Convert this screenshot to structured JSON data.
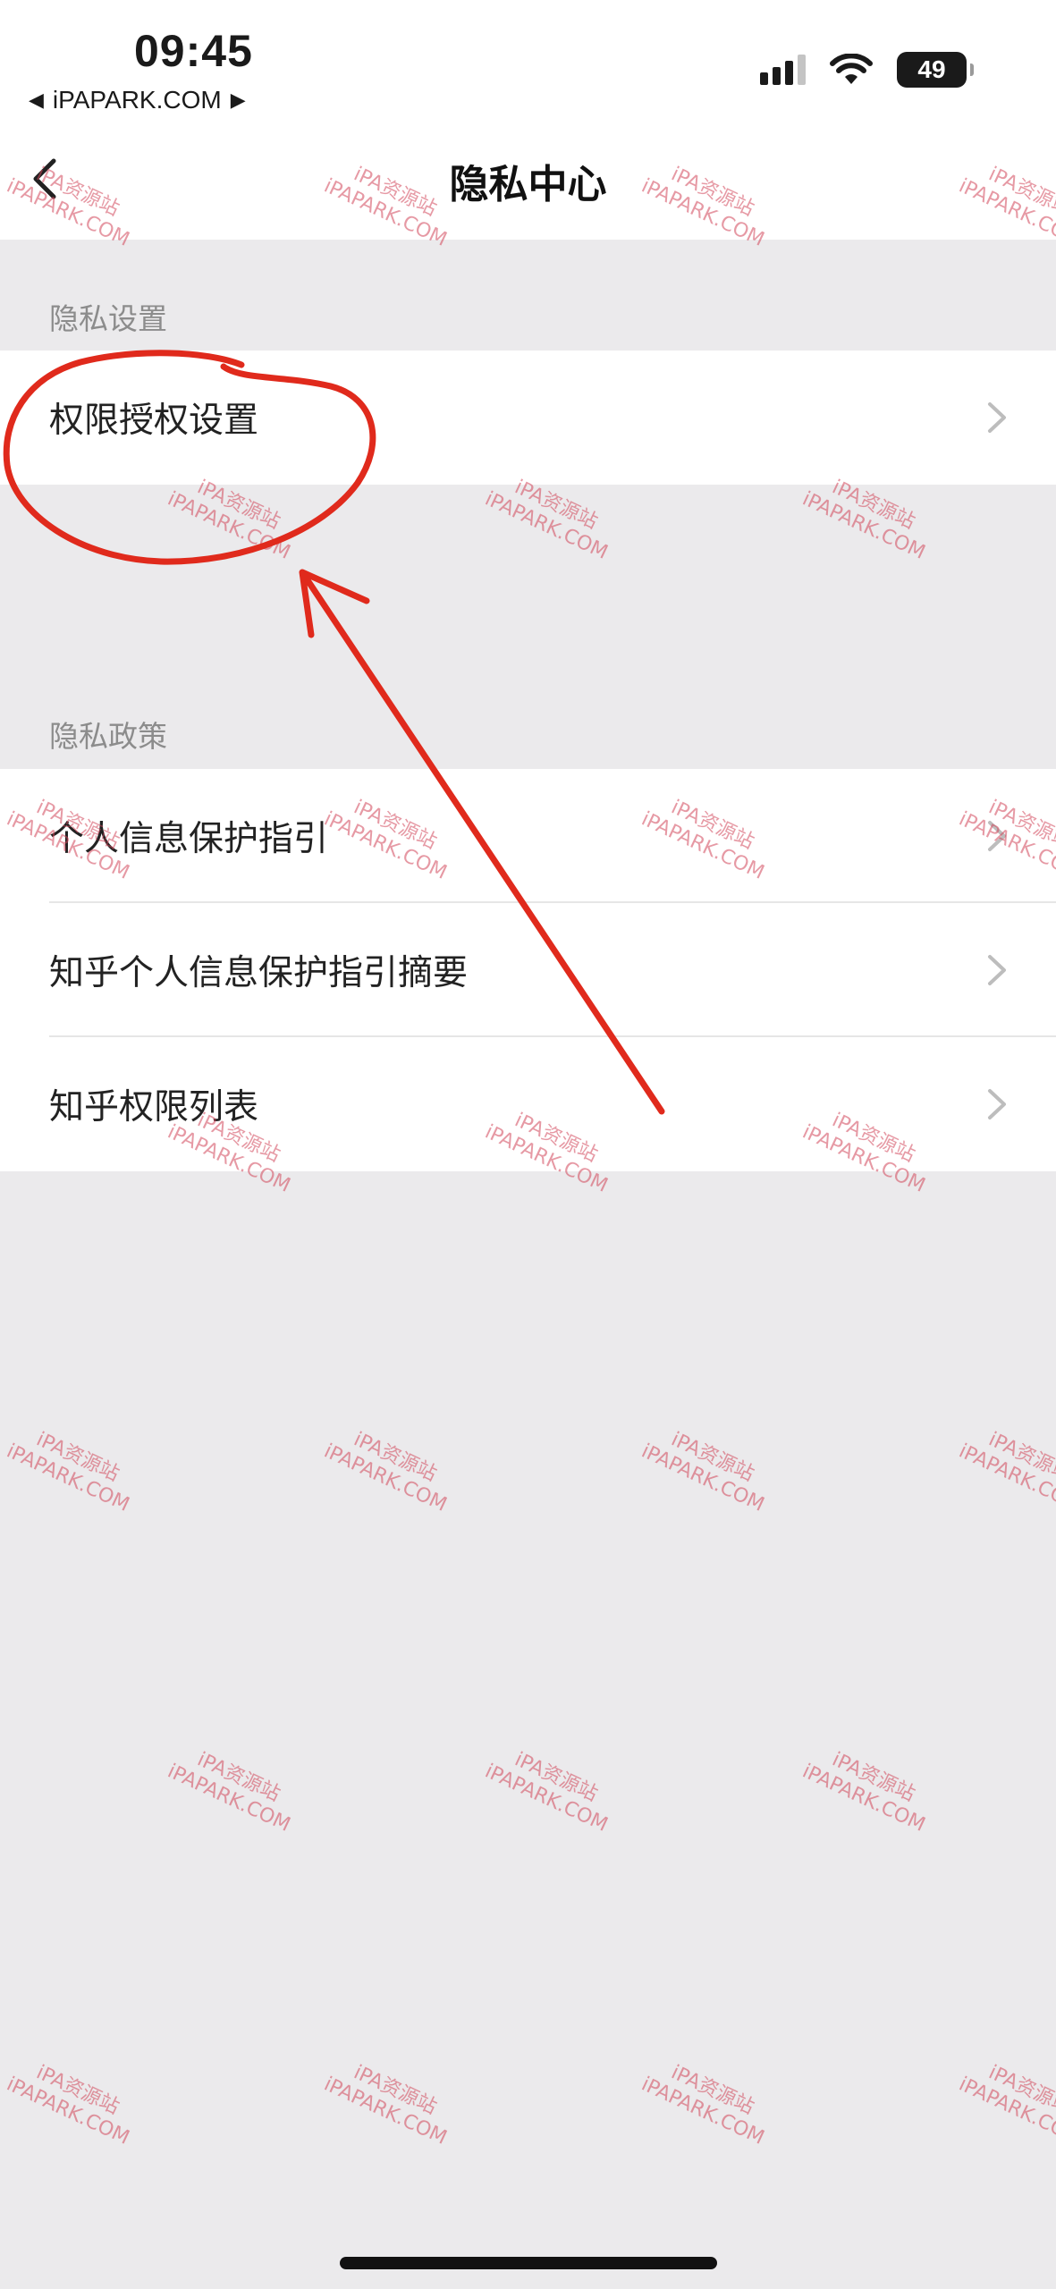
{
  "status_bar": {
    "time": "09:45",
    "back_app_label": "iPAPARK.COM",
    "battery_level": "49",
    "icons": [
      "signal-icon",
      "wifi-icon",
      "battery-icon"
    ]
  },
  "nav": {
    "title": "隐私中心",
    "back_icon": "chevron-left-icon"
  },
  "sections": [
    {
      "header": "隐私设置",
      "items": [
        {
          "label": "权限授权设置"
        }
      ]
    },
    {
      "header": "隐私政策",
      "items": [
        {
          "label": "个人信息保护指引"
        },
        {
          "label": "知乎个人信息保护指引摘要"
        },
        {
          "label": "知乎权限列表"
        }
      ]
    }
  ],
  "watermark": {
    "line1": "iPA资源站",
    "line2": "iPAPARK.COM"
  },
  "annotation": {
    "color": "#e02a1c",
    "shapes": [
      "circle-annotation",
      "arrow-annotation"
    ]
  }
}
